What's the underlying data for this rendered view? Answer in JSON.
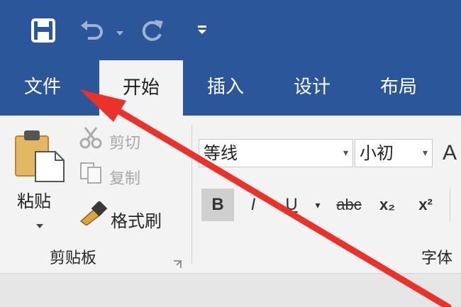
{
  "tabs": [
    {
      "label": "文件"
    },
    {
      "label": "开始"
    },
    {
      "label": "插入"
    },
    {
      "label": "设计"
    },
    {
      "label": "布局"
    }
  ],
  "clipboard": {
    "paste": "粘贴",
    "cut": "剪切",
    "copy": "复制",
    "format_painter": "格式刷",
    "group_label": "剪贴板"
  },
  "font": {
    "font_name": "等线",
    "font_size": "小初",
    "group_label": "字体",
    "bold": "B",
    "italic": "I",
    "underline": "U",
    "strikethrough": "abc",
    "subscript": "x₂",
    "superscript": "x²"
  },
  "colors": {
    "ribbon_blue": "#2b579a",
    "annotation_red": "#e8322a"
  }
}
